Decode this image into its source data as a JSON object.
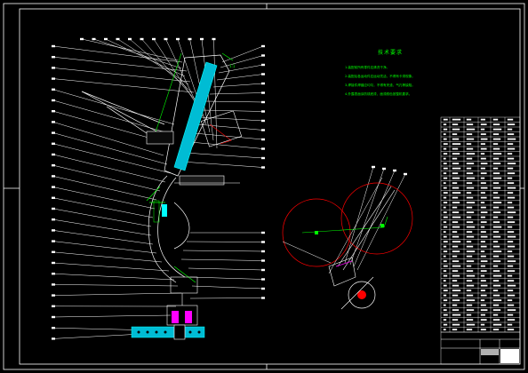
{
  "drawing": {
    "theme": {
      "background": "#000000",
      "frame": "#ffffff",
      "leader": "#ffffff",
      "part": "#00ffff",
      "dimension": "#00ff00",
      "circle": "#ff0000",
      "detail": "#ff00ff"
    },
    "tech_requirements": {
      "title": "技术要求",
      "lines": [
        "1.装配前所有零件应清洗干净。",
        "2.装配后各运动件应运动灵活，不得有卡滞现象。",
        "3.焊接件焊缝应均匀，不得有夹渣、气孔等缺陷。",
        "4.外露表面涂防锈底漆，面漆颜色按整机要求。"
      ]
    },
    "balloon_count_left": 28,
    "balloon_count_right": 22,
    "balloon_count_top": 12,
    "parts_list_rows": 44,
    "parts_list_cols": 6
  }
}
